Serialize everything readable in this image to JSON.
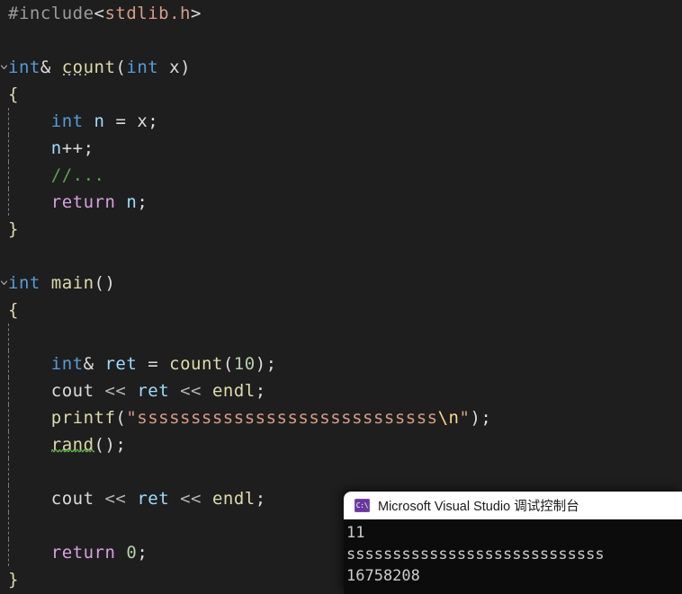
{
  "editor": {
    "background_color": "#1e1e1e",
    "lines": [
      {
        "indent_guides": [],
        "fold": false,
        "tokens": [
          {
            "text": "#include",
            "cls": "t-pre"
          },
          {
            "text": "<",
            "cls": "t-punc"
          },
          {
            "text": "stdlib.h",
            "cls": "t-str"
          },
          {
            "text": ">",
            "cls": "t-punc"
          }
        ]
      },
      {
        "indent_guides": [],
        "fold": false,
        "tokens": []
      },
      {
        "indent_guides": [],
        "fold": true,
        "tokens": [
          {
            "text": "int",
            "cls": "t-kw"
          },
          {
            "text": "& ",
            "cls": "t-punc"
          },
          {
            "text": "count",
            "cls": "t-fn",
            "hint": "dotted"
          },
          {
            "text": "(",
            "cls": "t-punc"
          },
          {
            "text": "int",
            "cls": "t-kw"
          },
          {
            "text": " ",
            "cls": "t-plain"
          },
          {
            "text": "x",
            "cls": "t-plain"
          },
          {
            "text": ")",
            "cls": "t-punc"
          }
        ]
      },
      {
        "indent_guides": [],
        "fold": false,
        "tokens": [
          {
            "text": "{",
            "cls": "t-brace"
          }
        ]
      },
      {
        "indent_guides": [
          0
        ],
        "fold": false,
        "tokens": [
          {
            "text": "    ",
            "cls": "t-plain"
          },
          {
            "text": "int",
            "cls": "t-kw"
          },
          {
            "text": " ",
            "cls": "t-plain"
          },
          {
            "text": "n",
            "cls": "t-var"
          },
          {
            "text": " = ",
            "cls": "t-plain"
          },
          {
            "text": "x",
            "cls": "t-plain"
          },
          {
            "text": ";",
            "cls": "t-punc"
          }
        ]
      },
      {
        "indent_guides": [
          0
        ],
        "fold": false,
        "tokens": [
          {
            "text": "    ",
            "cls": "t-plain"
          },
          {
            "text": "n",
            "cls": "t-var"
          },
          {
            "text": "++;",
            "cls": "t-punc"
          }
        ]
      },
      {
        "indent_guides": [
          0
        ],
        "fold": false,
        "tokens": [
          {
            "text": "    ",
            "cls": "t-plain"
          },
          {
            "text": "//...",
            "cls": "t-cmt"
          }
        ]
      },
      {
        "indent_guides": [
          0
        ],
        "fold": false,
        "tokens": [
          {
            "text": "    ",
            "cls": "t-plain"
          },
          {
            "text": "return",
            "cls": "t-ctrl"
          },
          {
            "text": " ",
            "cls": "t-plain"
          },
          {
            "text": "n",
            "cls": "t-var"
          },
          {
            "text": ";",
            "cls": "t-punc"
          }
        ]
      },
      {
        "indent_guides": [],
        "fold": false,
        "tokens": [
          {
            "text": "}",
            "cls": "t-brace"
          }
        ]
      },
      {
        "indent_guides": [],
        "fold": false,
        "tokens": []
      },
      {
        "indent_guides": [],
        "fold": true,
        "tokens": [
          {
            "text": "int",
            "cls": "t-kw"
          },
          {
            "text": " ",
            "cls": "t-plain"
          },
          {
            "text": "main",
            "cls": "t-fn"
          },
          {
            "text": "()",
            "cls": "t-punc"
          }
        ]
      },
      {
        "indent_guides": [],
        "fold": false,
        "tokens": [
          {
            "text": "{",
            "cls": "t-brace"
          }
        ]
      },
      {
        "indent_guides": [
          0
        ],
        "fold": false,
        "tokens": []
      },
      {
        "indent_guides": [
          0
        ],
        "fold": false,
        "tokens": [
          {
            "text": "    ",
            "cls": "t-plain"
          },
          {
            "text": "int",
            "cls": "t-kw"
          },
          {
            "text": "& ",
            "cls": "t-punc"
          },
          {
            "text": "ret",
            "cls": "t-var"
          },
          {
            "text": " = ",
            "cls": "t-plain"
          },
          {
            "text": "count",
            "cls": "t-fn"
          },
          {
            "text": "(",
            "cls": "t-punc"
          },
          {
            "text": "10",
            "cls": "t-num"
          },
          {
            "text": ");",
            "cls": "t-punc"
          }
        ]
      },
      {
        "indent_guides": [
          0
        ],
        "fold": false,
        "tokens": [
          {
            "text": "    ",
            "cls": "t-plain"
          },
          {
            "text": "cout",
            "cls": "t-plain"
          },
          {
            "text": " ",
            "cls": "t-plain"
          },
          {
            "text": "<<",
            "cls": "t-op"
          },
          {
            "text": " ",
            "cls": "t-plain"
          },
          {
            "text": "ret",
            "cls": "t-var"
          },
          {
            "text": " ",
            "cls": "t-plain"
          },
          {
            "text": "<<",
            "cls": "t-op"
          },
          {
            "text": " ",
            "cls": "t-plain"
          },
          {
            "text": "endl",
            "cls": "t-fn"
          },
          {
            "text": ";",
            "cls": "t-punc"
          }
        ]
      },
      {
        "indent_guides": [
          0
        ],
        "fold": false,
        "tokens": [
          {
            "text": "    ",
            "cls": "t-plain"
          },
          {
            "text": "printf",
            "cls": "t-fn"
          },
          {
            "text": "(",
            "cls": "t-punc"
          },
          {
            "text": "\"ssssssssssssssssssssssssssss",
            "cls": "t-str"
          },
          {
            "text": "\\n",
            "cls": "t-esc"
          },
          {
            "text": "\"",
            "cls": "t-str"
          },
          {
            "text": ");",
            "cls": "t-punc"
          }
        ]
      },
      {
        "indent_guides": [
          0
        ],
        "fold": false,
        "tokens": [
          {
            "text": "    ",
            "cls": "t-plain"
          },
          {
            "text": "rand",
            "cls": "t-fn",
            "hint": "squiggle"
          },
          {
            "text": "()",
            "cls": "t-punc"
          },
          {
            "text": ";",
            "cls": "t-punc"
          }
        ]
      },
      {
        "indent_guides": [
          0
        ],
        "fold": false,
        "tokens": []
      },
      {
        "indent_guides": [
          0
        ],
        "fold": false,
        "tokens": [
          {
            "text": "    ",
            "cls": "t-plain"
          },
          {
            "text": "cout",
            "cls": "t-plain"
          },
          {
            "text": " ",
            "cls": "t-plain"
          },
          {
            "text": "<<",
            "cls": "t-op"
          },
          {
            "text": " ",
            "cls": "t-plain"
          },
          {
            "text": "ret",
            "cls": "t-var"
          },
          {
            "text": " ",
            "cls": "t-plain"
          },
          {
            "text": "<<",
            "cls": "t-op"
          },
          {
            "text": " ",
            "cls": "t-plain"
          },
          {
            "text": "endl",
            "cls": "t-fn"
          },
          {
            "text": ";",
            "cls": "t-punc"
          }
        ]
      },
      {
        "indent_guides": [
          0
        ],
        "fold": false,
        "tokens": []
      },
      {
        "indent_guides": [
          0
        ],
        "fold": false,
        "tokens": [
          {
            "text": "    ",
            "cls": "t-plain"
          },
          {
            "text": "return",
            "cls": "t-ctrl"
          },
          {
            "text": " ",
            "cls": "t-plain"
          },
          {
            "text": "0",
            "cls": "t-num"
          },
          {
            "text": ";",
            "cls": "t-punc"
          }
        ]
      },
      {
        "indent_guides": [],
        "fold": false,
        "tokens": [
          {
            "text": "}",
            "cls": "t-brace"
          }
        ]
      }
    ]
  },
  "console": {
    "title": "Microsoft Visual Studio 调试控制台",
    "icon_label": "C:\\",
    "icon_color": "#68399c",
    "titlebar_color": "#ffffff",
    "background_color": "#0c0c0c",
    "output_lines": [
      "11",
      "ssssssssssssssssssssssssssss",
      "16758208"
    ]
  }
}
